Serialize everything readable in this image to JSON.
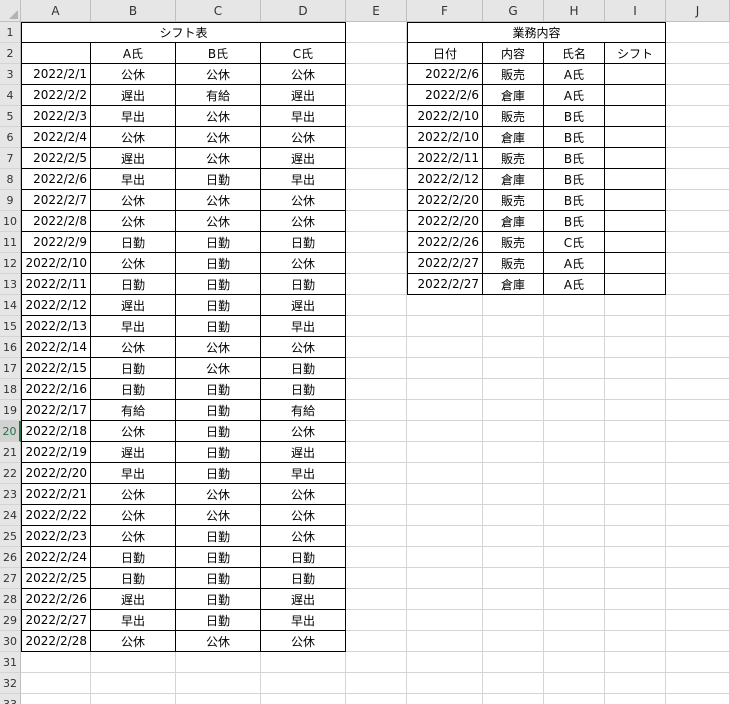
{
  "columns": [
    "A",
    "B",
    "C",
    "D",
    "E",
    "F",
    "G",
    "H",
    "I",
    "J"
  ],
  "row_count": 33,
  "active_row": 20,
  "shift_table": {
    "title": "シフト表",
    "headers": [
      "",
      "A氏",
      "B氏",
      "C氏"
    ],
    "rows": [
      [
        "2022/2/1",
        "公休",
        "公休",
        "公休"
      ],
      [
        "2022/2/2",
        "遅出",
        "有給",
        "遅出"
      ],
      [
        "2022/2/3",
        "早出",
        "公休",
        "早出"
      ],
      [
        "2022/2/4",
        "公休",
        "公休",
        "公休"
      ],
      [
        "2022/2/5",
        "遅出",
        "公休",
        "遅出"
      ],
      [
        "2022/2/6",
        "早出",
        "日勤",
        "早出"
      ],
      [
        "2022/2/7",
        "公休",
        "公休",
        "公休"
      ],
      [
        "2022/2/8",
        "公休",
        "公休",
        "公休"
      ],
      [
        "2022/2/9",
        "日勤",
        "日勤",
        "日勤"
      ],
      [
        "2022/2/10",
        "公休",
        "日勤",
        "公休"
      ],
      [
        "2022/2/11",
        "日勤",
        "日勤",
        "日勤"
      ],
      [
        "2022/2/12",
        "遅出",
        "日勤",
        "遅出"
      ],
      [
        "2022/2/13",
        "早出",
        "日勤",
        "早出"
      ],
      [
        "2022/2/14",
        "公休",
        "公休",
        "公休"
      ],
      [
        "2022/2/15",
        "日勤",
        "公休",
        "日勤"
      ],
      [
        "2022/2/16",
        "日勤",
        "日勤",
        "日勤"
      ],
      [
        "2022/2/17",
        "有給",
        "日勤",
        "有給"
      ],
      [
        "2022/2/18",
        "公休",
        "日勤",
        "公休"
      ],
      [
        "2022/2/19",
        "遅出",
        "日勤",
        "遅出"
      ],
      [
        "2022/2/20",
        "早出",
        "日勤",
        "早出"
      ],
      [
        "2022/2/21",
        "公休",
        "公休",
        "公休"
      ],
      [
        "2022/2/22",
        "公休",
        "公休",
        "公休"
      ],
      [
        "2022/2/23",
        "公休",
        "日勤",
        "公休"
      ],
      [
        "2022/2/24",
        "日勤",
        "日勤",
        "日勤"
      ],
      [
        "2022/2/25",
        "日勤",
        "日勤",
        "日勤"
      ],
      [
        "2022/2/26",
        "遅出",
        "日勤",
        "遅出"
      ],
      [
        "2022/2/27",
        "早出",
        "日勤",
        "早出"
      ],
      [
        "2022/2/28",
        "公休",
        "公休",
        "公休"
      ]
    ]
  },
  "work_table": {
    "title": "業務内容",
    "headers": [
      "日付",
      "内容",
      "氏名",
      "シフト"
    ],
    "rows": [
      [
        "2022/2/6",
        "販売",
        "A氏",
        ""
      ],
      [
        "2022/2/6",
        "倉庫",
        "A氏",
        ""
      ],
      [
        "2022/2/10",
        "販売",
        "B氏",
        ""
      ],
      [
        "2022/2/10",
        "倉庫",
        "B氏",
        ""
      ],
      [
        "2022/2/11",
        "販売",
        "B氏",
        ""
      ],
      [
        "2022/2/12",
        "倉庫",
        "B氏",
        ""
      ],
      [
        "2022/2/20",
        "販売",
        "B氏",
        ""
      ],
      [
        "2022/2/20",
        "倉庫",
        "B氏",
        ""
      ],
      [
        "2022/2/26",
        "販売",
        "C氏",
        ""
      ],
      [
        "2022/2/27",
        "販売",
        "A氏",
        ""
      ],
      [
        "2022/2/27",
        "倉庫",
        "A氏",
        ""
      ]
    ]
  }
}
